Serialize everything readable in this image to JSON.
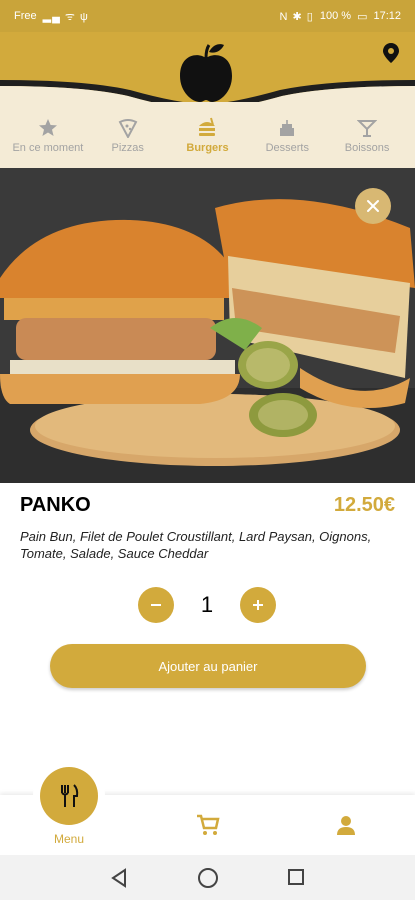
{
  "status_bar": {
    "carrier": "Free",
    "battery": "100 %",
    "time": "17:12"
  },
  "header": {
    "logo_icon": "apple-logo-icon",
    "location_icon": "location-pin-icon"
  },
  "tabs": [
    {
      "label": "En ce moment",
      "icon": "star-icon",
      "active": false
    },
    {
      "label": "Pizzas",
      "icon": "pizza-icon",
      "active": false
    },
    {
      "label": "Burgers",
      "icon": "burger-icon",
      "active": true
    },
    {
      "label": "Desserts",
      "icon": "cake-icon",
      "active": false
    },
    {
      "label": "Boissons",
      "icon": "cocktail-icon",
      "active": false
    }
  ],
  "product": {
    "name": "PANKO",
    "price": "12.50€",
    "description": "Pain Bun, Filet de Poulet Croustillant, Lard Paysan, Oignons, Tomate, Salade, Sauce Cheddar",
    "quantity": "1"
  },
  "actions": {
    "add_to_cart": "Ajouter au panier"
  },
  "bottom_nav": {
    "menu_label": "Menu"
  },
  "colors": {
    "accent": "#d2aa3c",
    "tab_bg": "#f4ebd6",
    "inactive": "#a3a3a3"
  }
}
